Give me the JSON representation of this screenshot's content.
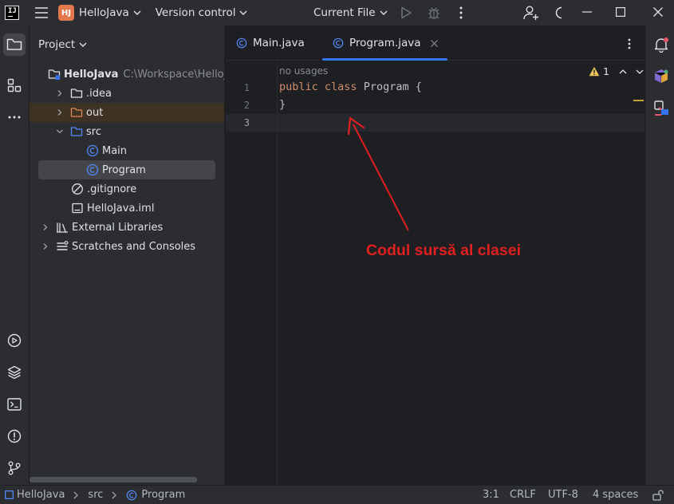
{
  "titlebar": {
    "project_badge": "HJ",
    "project_name": "HelloJava",
    "vcs_label": "Version control",
    "run_config": "Current File"
  },
  "project_panel": {
    "title": "Project",
    "tree": [
      {
        "label": "HelloJava",
        "path": "C:\\Workspace\\HelloJ"
      },
      {
        "label": ".idea"
      },
      {
        "label": "out"
      },
      {
        "label": "src"
      },
      {
        "label": "Main"
      },
      {
        "label": "Program"
      },
      {
        "label": ".gitignore"
      },
      {
        "label": "HelloJava.iml"
      },
      {
        "label": "External Libraries"
      },
      {
        "label": "Scratches and Consoles"
      }
    ]
  },
  "editor": {
    "tabs": [
      {
        "label": "Main.java"
      },
      {
        "label": "Program.java"
      }
    ],
    "usage_hint": "no usages",
    "warnings_count": "1",
    "line_numbers": [
      "1",
      "2",
      "3"
    ],
    "code": {
      "kw_public": "public",
      "kw_class": "class",
      "class_name": " Program ",
      "open_brace": "{",
      "close_brace": "}"
    }
  },
  "annotation": {
    "text": "Codul sursă al clasei",
    "color": "#e01f1f"
  },
  "statusbar": {
    "breadcrumb": [
      "HelloJava",
      "src",
      "Program"
    ],
    "position": "3:1",
    "line_sep": "CRLF",
    "encoding": "UTF-8",
    "indent": "4 spaces"
  },
  "colors": {
    "accent": "#3574f0",
    "keyword": "#cf8e6d",
    "folder_excluded_bg": "#3d3223"
  }
}
